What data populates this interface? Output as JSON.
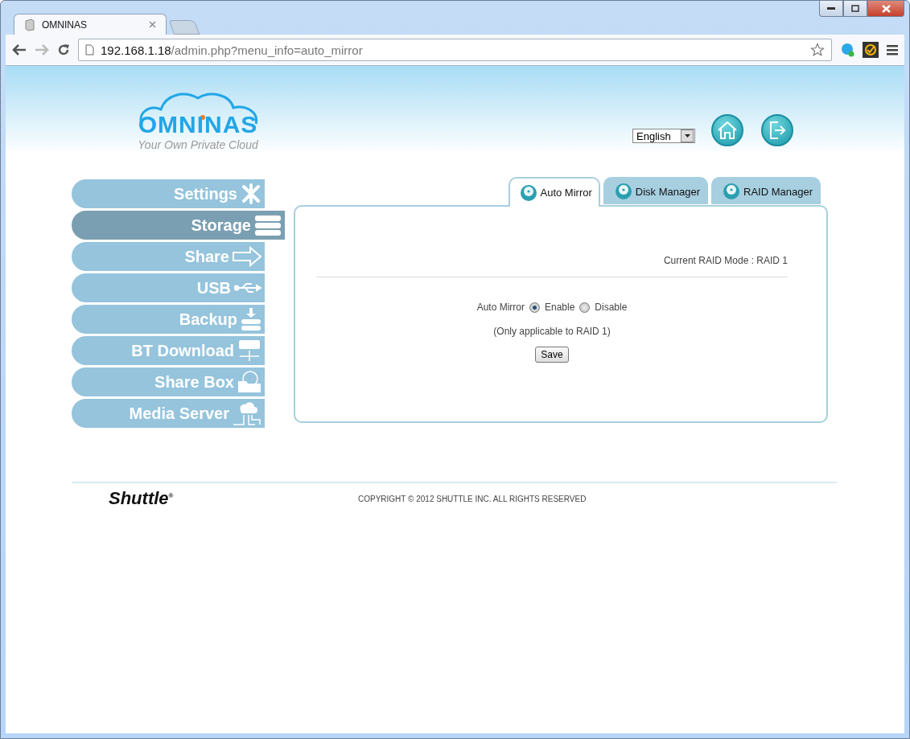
{
  "browser": {
    "tabs": [
      {
        "title": "OMNINAS",
        "selected": true
      }
    ],
    "url": {
      "host": "192.168.1.18",
      "path": "/admin.php?menu_info=auto_mirror"
    }
  },
  "header": {
    "logo": {
      "name": "OMNINAS",
      "tagline": "Your Own Private Cloud"
    },
    "language": {
      "value": "English"
    }
  },
  "sidebar": {
    "items": [
      {
        "label": "Settings",
        "selected": false
      },
      {
        "label": "Storage",
        "selected": true
      },
      {
        "label": "Share",
        "selected": false
      },
      {
        "label": "USB",
        "selected": false
      },
      {
        "label": "Backup",
        "selected": false
      },
      {
        "label": "BT Download",
        "selected": false
      },
      {
        "label": "Share Box",
        "selected": false
      },
      {
        "label": "Media Server",
        "selected": false
      }
    ]
  },
  "tabs": [
    {
      "label": "Auto Mirror",
      "selected": true
    },
    {
      "label": "Disk Manager",
      "selected": false
    },
    {
      "label": "RAID Manager",
      "selected": false
    }
  ],
  "panel": {
    "raid_mode": "Current RAID Mode : RAID 1",
    "auto_mirror": {
      "label": "Auto Mirror",
      "options": [
        {
          "label": "Enable",
          "selected": true
        },
        {
          "label": "Disable",
          "selected": false
        }
      ]
    },
    "note": "(Only applicable to RAID 1)",
    "save": "Save"
  },
  "footer": {
    "brand": "Shuttle$^{®}$",
    "copyright": "COPYRIGHT © 2012 SHUTTLE INC. ALL RIGHTS RESERVED"
  }
}
